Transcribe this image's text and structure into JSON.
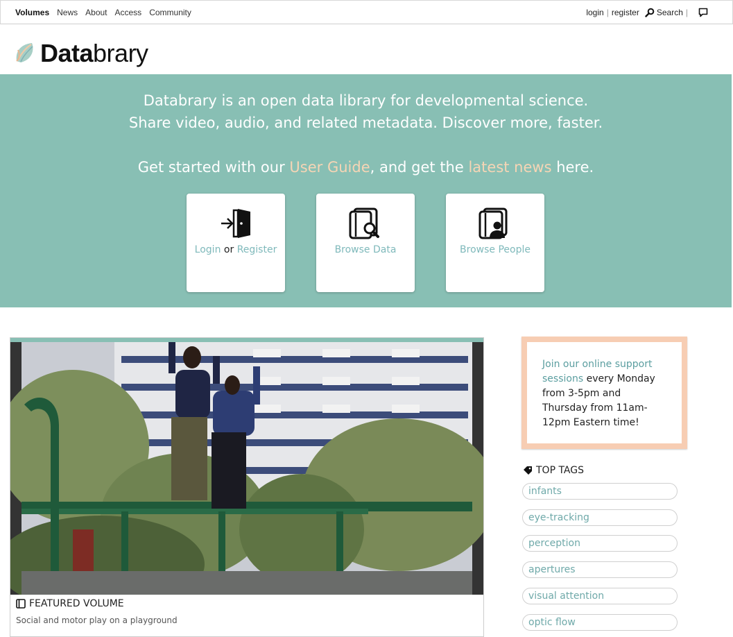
{
  "nav": {
    "left": [
      "Volumes",
      "News",
      "About",
      "Access",
      "Community"
    ],
    "login": "login",
    "register": "register",
    "search": "Search"
  },
  "logo": {
    "text_bold": "Data",
    "text_rest": "brary"
  },
  "hero": {
    "line1": "Databrary is an open data library for developmental science.",
    "line2": "Share video, audio, and related metadata. Discover more, faster.",
    "line3_pre": "Get started with our ",
    "user_guide": "User Guide",
    "line3_mid": ", and get the ",
    "latest_news": "latest news",
    "line3_post": " here."
  },
  "cards": {
    "login": "Login",
    "or": " or ",
    "register": "Register",
    "browse_data": "Browse Data",
    "browse_people": "Browse People"
  },
  "featured": {
    "label": "FEATURED VOLUME",
    "title": "Social and motor play on a playground"
  },
  "support": {
    "link": "Join our online support sessions",
    "text": " every Monday from 3-5pm and Thursday from 11am-12pm Eastern time!"
  },
  "tags": {
    "heading": "TOP TAGS",
    "items": [
      "infants",
      "eye-tracking",
      "perception",
      "apertures",
      "visual attention",
      "optic flow"
    ]
  },
  "colors": {
    "hero": "#88bfb4",
    "accent_orange": "#f6d5b5",
    "teal_text": "#7fb9bb",
    "support_border": "#f7cdb3"
  }
}
